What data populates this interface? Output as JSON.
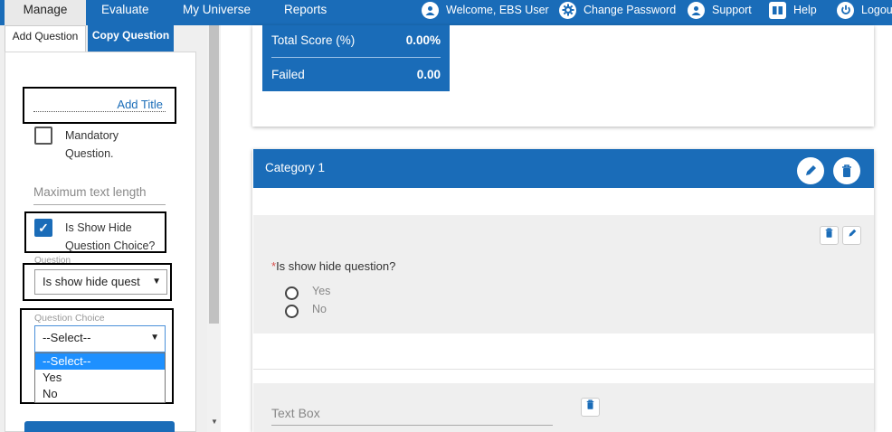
{
  "topnav": {
    "items": [
      "Manage",
      "Evaluate",
      "My Universe",
      "Reports"
    ],
    "welcome": "Welcome, EBS User",
    "change_password": "Change Password",
    "support": "Support",
    "help": "Help",
    "logout": "Logout"
  },
  "left_panel": {
    "tabs": [
      "Add Question",
      "Copy Question"
    ],
    "add_title": "Add Title",
    "mandatory_line1": "Mandatory",
    "mandatory_line2": "Question.",
    "max_length_placeholder": "Maximum text length",
    "show_hide_line1": "Is Show Hide",
    "show_hide_line2": "Question Choice?",
    "question_label": "Question",
    "question_selected": "Is show hide quest",
    "question_choice_label": "Question Choice",
    "choice_selected": "--Select--",
    "choice_options": [
      "--Select--",
      "Yes",
      "No"
    ]
  },
  "score": {
    "total_label": "Total Score (%)",
    "total_value": "0.00%",
    "failed_label": "Failed",
    "failed_value": "0.00"
  },
  "category": {
    "title": "Category 1",
    "question_required_mark": "*",
    "question_text": "Is show hide question?",
    "options": [
      "Yes",
      "No"
    ],
    "textbox_placeholder": "Text Box"
  },
  "colors": {
    "primary": "#1a6cb8",
    "selected_option": "#1e90ff"
  },
  "icons": [
    "user-icon",
    "gear-icon",
    "support-icon",
    "help-book-icon",
    "power-icon",
    "pencil-icon",
    "trash-icon"
  ]
}
